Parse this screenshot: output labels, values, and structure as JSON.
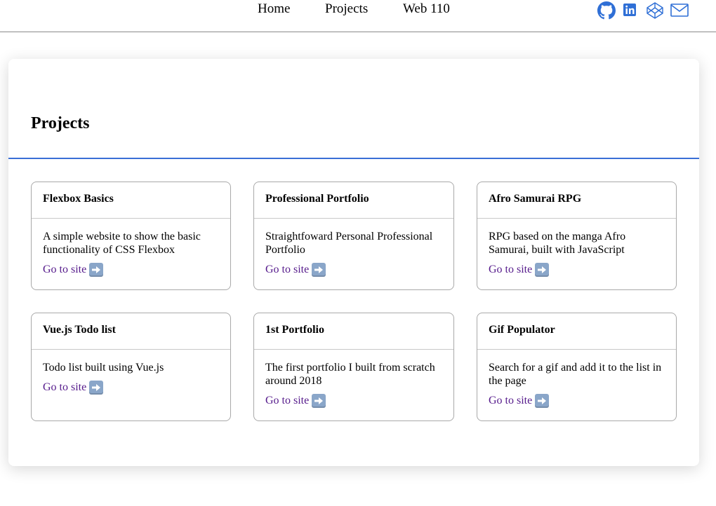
{
  "nav": {
    "links": [
      "Home",
      "Projects",
      "Web 110"
    ],
    "social_icons": [
      "github-icon",
      "linkedin-icon",
      "codepen-icon",
      "mail-icon"
    ]
  },
  "section": {
    "title": "Projects"
  },
  "projects": [
    {
      "title": "Flexbox Basics",
      "description": "A simple website to show the basic functionality of CSS Flexbox",
      "link": "Go to site"
    },
    {
      "title": "Professional Portfolio",
      "description": "Straightfoward Personal Professional Portfolio",
      "link": "Go to site"
    },
    {
      "title": "Afro Samurai RPG",
      "description": "RPG based on the manga Afro Samurai, built with JavaScript",
      "link": "Go to site"
    },
    {
      "title": "Vue.js Todo list",
      "description": "Todo list built using Vue.js",
      "link": "Go to site"
    },
    {
      "title": "1st Portfolio",
      "description": "The first portfolio I built from scratch around 2018",
      "link": "Go to site"
    },
    {
      "title": "Gif Populator",
      "description": "Search for a gif and add it to the list in the page",
      "link": "Go to site"
    }
  ],
  "colors": {
    "accent": "#3a6fd6",
    "link_visited": "#551a8b",
    "social_blue": "#2f6fd6"
  }
}
